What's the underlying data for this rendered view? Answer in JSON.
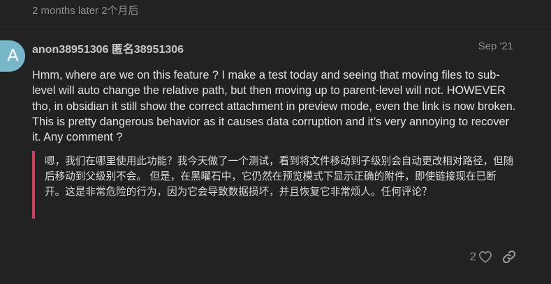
{
  "time_gap": "2 months later 2个月后",
  "post": {
    "avatar_letter": "A",
    "username": "anon38951306 匿名38951306",
    "date": "Sep '21",
    "body": "Hmm, where are we on this feature ? I make a test today and seeing that moving files to sub-level will auto change the relative path, but then moving up to parent-level will not. HOWEVER tho, in obsidian it still show the correct attachment in preview mode, even the link is now broken. This is pretty dangerous behavior as it causes data corruption and it’s very annoying to recover it. Any comment ?",
    "quote": "嗯，我们在哪里使用此功能？我今天做了一个测试，看到将文件移动到子级别会自动更改相对路径，但随后移动到父级别不会。 但是，在黑曜石中，它仍然在预览模式下显示正确的附件，即使链接现在已断开。这是非常危险的行为，因为它会导致数据损坏，并且恢复它非常烦人。任何评论？",
    "like_count": "2",
    "icons": {
      "like": "heart-icon",
      "share": "link-icon"
    },
    "colors": {
      "avatar": "#78b7c9",
      "quote_border": "#d23e5f"
    }
  }
}
